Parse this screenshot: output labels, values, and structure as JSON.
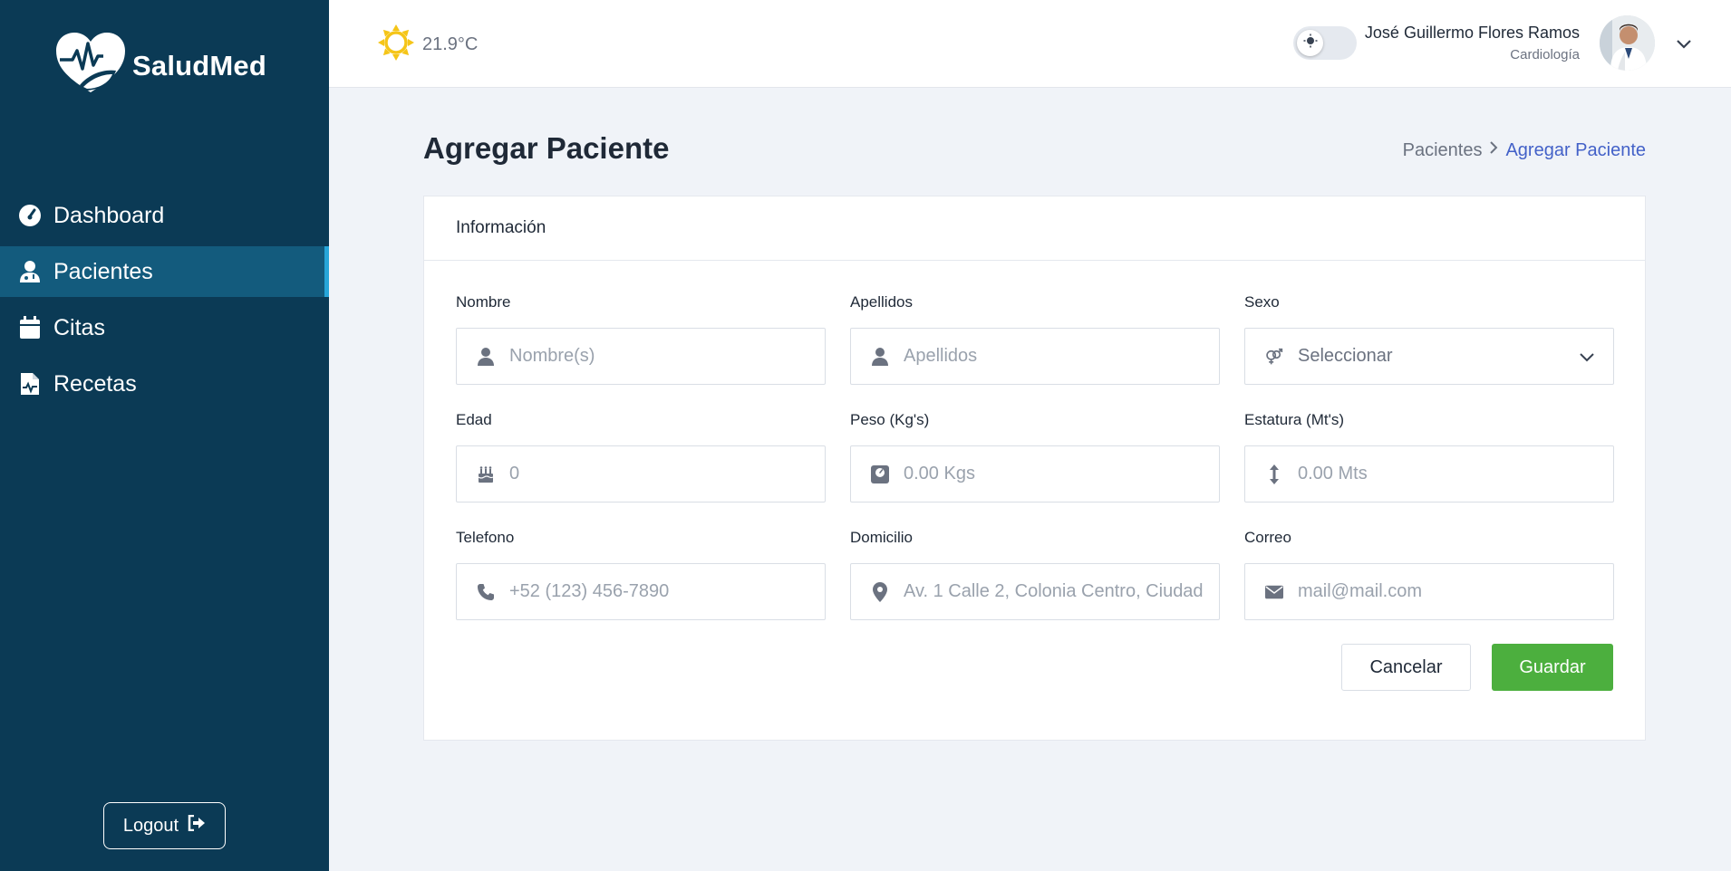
{
  "brand": {
    "name": "SaludMed"
  },
  "sidebar": {
    "items": [
      {
        "label": "Dashboard",
        "icon": "gauge-icon",
        "active": false
      },
      {
        "label": "Pacientes",
        "icon": "user-doctor-icon",
        "active": true
      },
      {
        "label": "Citas",
        "icon": "calendar-icon",
        "active": false
      },
      {
        "label": "Recetas",
        "icon": "prescription-file-icon",
        "active": false
      }
    ],
    "logout_label": "Logout"
  },
  "header": {
    "temperature": "21.9°C",
    "weather_icon": "sun-icon",
    "user_name": "José Guillermo Flores Ramos",
    "user_department": "Cardiología"
  },
  "page": {
    "title": "Agregar Paciente",
    "breadcrumb": {
      "parent": "Pacientes",
      "current": "Agregar Paciente"
    }
  },
  "form": {
    "section_title": "Información",
    "fields": {
      "nombre": {
        "label": "Nombre",
        "placeholder": "Nombre(s)",
        "value": ""
      },
      "apellidos": {
        "label": "Apellidos",
        "placeholder": "Apellidos",
        "value": ""
      },
      "sexo": {
        "label": "Sexo",
        "selected": "Seleccionar"
      },
      "edad": {
        "label": "Edad",
        "placeholder": "0",
        "value": ""
      },
      "peso": {
        "label": "Peso (Kg's)",
        "placeholder": "0.00 Kgs",
        "value": ""
      },
      "estatura": {
        "label": "Estatura (Mt's)",
        "placeholder": "0.00 Mts",
        "value": ""
      },
      "telefono": {
        "label": "Telefono",
        "placeholder": "+52 (123) 456-7890",
        "value": ""
      },
      "domicilio": {
        "label": "Domicilio",
        "placeholder": "Av. 1 Calle 2, Colonia Centro, Ciudad",
        "value": ""
      },
      "correo": {
        "label": "Correo",
        "placeholder": "mail@mail.com",
        "value": ""
      }
    },
    "cancel_label": "Cancelar",
    "save_label": "Guardar"
  },
  "colors": {
    "sidebar_bg": "#0b3a55",
    "sidebar_active": "#135b7d",
    "accent_blue": "#4361c8",
    "save_green": "#4caf3e",
    "sun_yellow": "#f5c518"
  }
}
